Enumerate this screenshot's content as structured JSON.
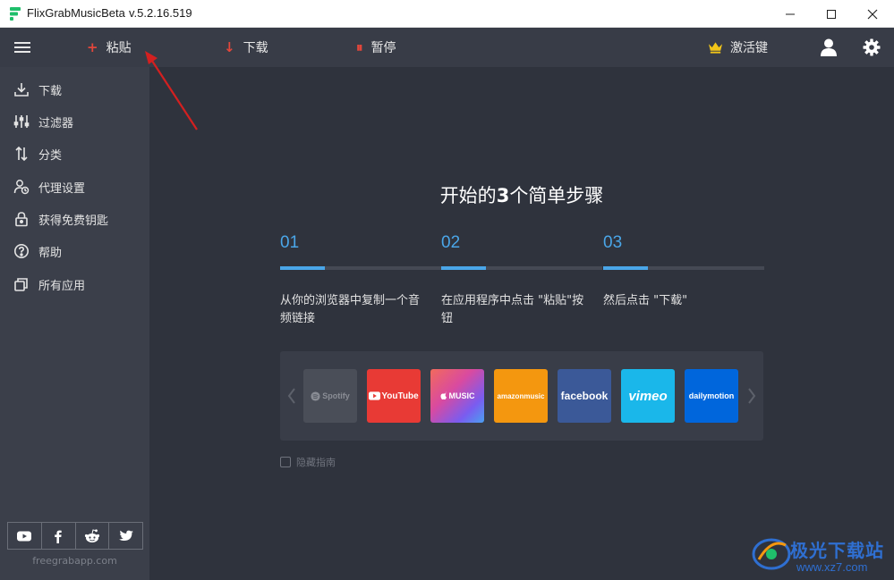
{
  "window": {
    "title": "FlixGrabMusicBeta",
    "version": "v.5.2.16.519"
  },
  "toolbar": {
    "paste_label": "粘贴",
    "download_label": "下载",
    "pause_label": "暂停",
    "activation_label": "激活键"
  },
  "sidebar": {
    "items": [
      {
        "label": "下载",
        "icon": "download-icon"
      },
      {
        "label": "过滤器",
        "icon": "filter-sliders-icon"
      },
      {
        "label": "分类",
        "icon": "sort-arrows-icon"
      },
      {
        "label": "代理设置",
        "icon": "proxy-icon"
      },
      {
        "label": "获得免费钥匙",
        "icon": "lock-icon"
      },
      {
        "label": "帮助",
        "icon": "help-icon"
      },
      {
        "label": "所有应用",
        "icon": "apps-icon"
      }
    ],
    "social": [
      "youtube-icon",
      "facebook-icon",
      "reddit-icon",
      "twitter-icon"
    ],
    "site": "freegrabapp.com"
  },
  "guide": {
    "title_pre": "开始的",
    "title_num": "3",
    "title_post": "个简单步骤",
    "steps": [
      {
        "num": "01",
        "desc": "从你的浏览器中复制一个音频链接"
      },
      {
        "num": "02",
        "desc": "在应用程序中点击 \"粘贴\"按钮"
      },
      {
        "num": "03",
        "desc": "然后点击 \"下载\""
      }
    ],
    "services": [
      {
        "label": "Spotify",
        "color": "#4a4e58"
      },
      {
        "label": "YouTube",
        "color": "#e83a35"
      },
      {
        "label": "MUSIC",
        "color": "#d94aa0"
      },
      {
        "label": "amazonmusic",
        "color": "#f4970f"
      },
      {
        "label": "facebook",
        "color": "#3b5998"
      },
      {
        "label": "vimeo",
        "color": "#1ab7ea"
      },
      {
        "label": "dailymotion",
        "color": "#0066dc"
      }
    ],
    "hide_label": "隐藏指南"
  },
  "watermark": {
    "text": "极光下载站",
    "url": "www.xz7.com"
  },
  "colors": {
    "accent_blue": "#4aa6e8",
    "accent_red": "#e2463b",
    "crown_gold": "#f0c419"
  }
}
